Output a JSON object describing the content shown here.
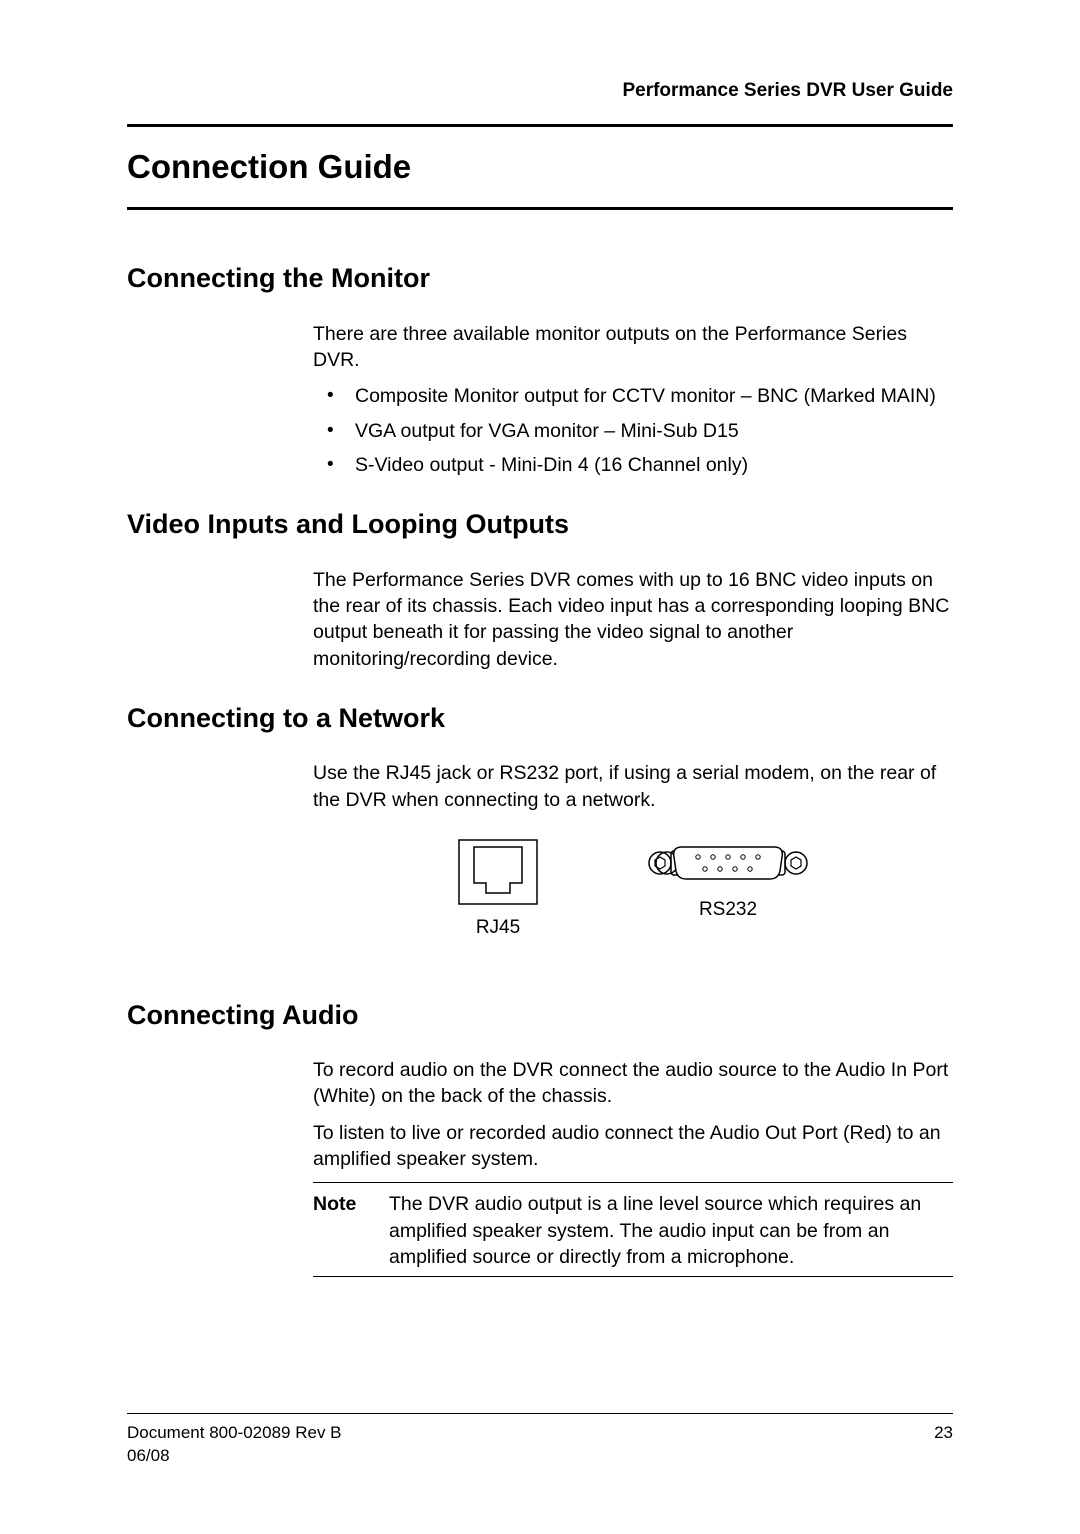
{
  "header": {
    "guide_title": "Performance Series DVR User Guide"
  },
  "title": "Connection Guide",
  "sections": {
    "monitor": {
      "heading": "Connecting the Monitor",
      "intro": "There are three available monitor outputs on the Performance Series DVR.",
      "bullets": [
        "Composite Monitor output for CCTV monitor – BNC (Marked MAIN)",
        "VGA output for VGA monitor – Mini-Sub D15",
        "S-Video output - Mini-Din 4 (16 Channel only)"
      ]
    },
    "video": {
      "heading": "Video Inputs and Looping Outputs",
      "text": "The Performance Series DVR comes with up to 16 BNC video inputs on the rear of its chassis. Each video input has a corresponding looping BNC output beneath it for passing the video signal to another monitoring/recording device."
    },
    "network": {
      "heading": "Connecting to a Network",
      "text": "Use the RJ45 jack or RS232 port, if using a serial modem, on the rear of the DVR when connecting to a network.",
      "fig_rj45": "RJ45",
      "fig_rs232": "RS232"
    },
    "audio": {
      "heading": "Connecting Audio",
      "p1": "To record audio on the DVR connect the audio source to the Audio In Port (White) on the back of the chassis.",
      "p2": "To listen to live or recorded audio connect the Audio Out Port (Red) to an amplified speaker system.",
      "note_label": "Note",
      "note_text": "The DVR audio output is a line level source which requires an amplified speaker system. The audio input can be from an amplified source or directly from a microphone."
    }
  },
  "footer": {
    "doc": "Document 800-02089  Rev B",
    "page": "23",
    "date": "06/08"
  }
}
